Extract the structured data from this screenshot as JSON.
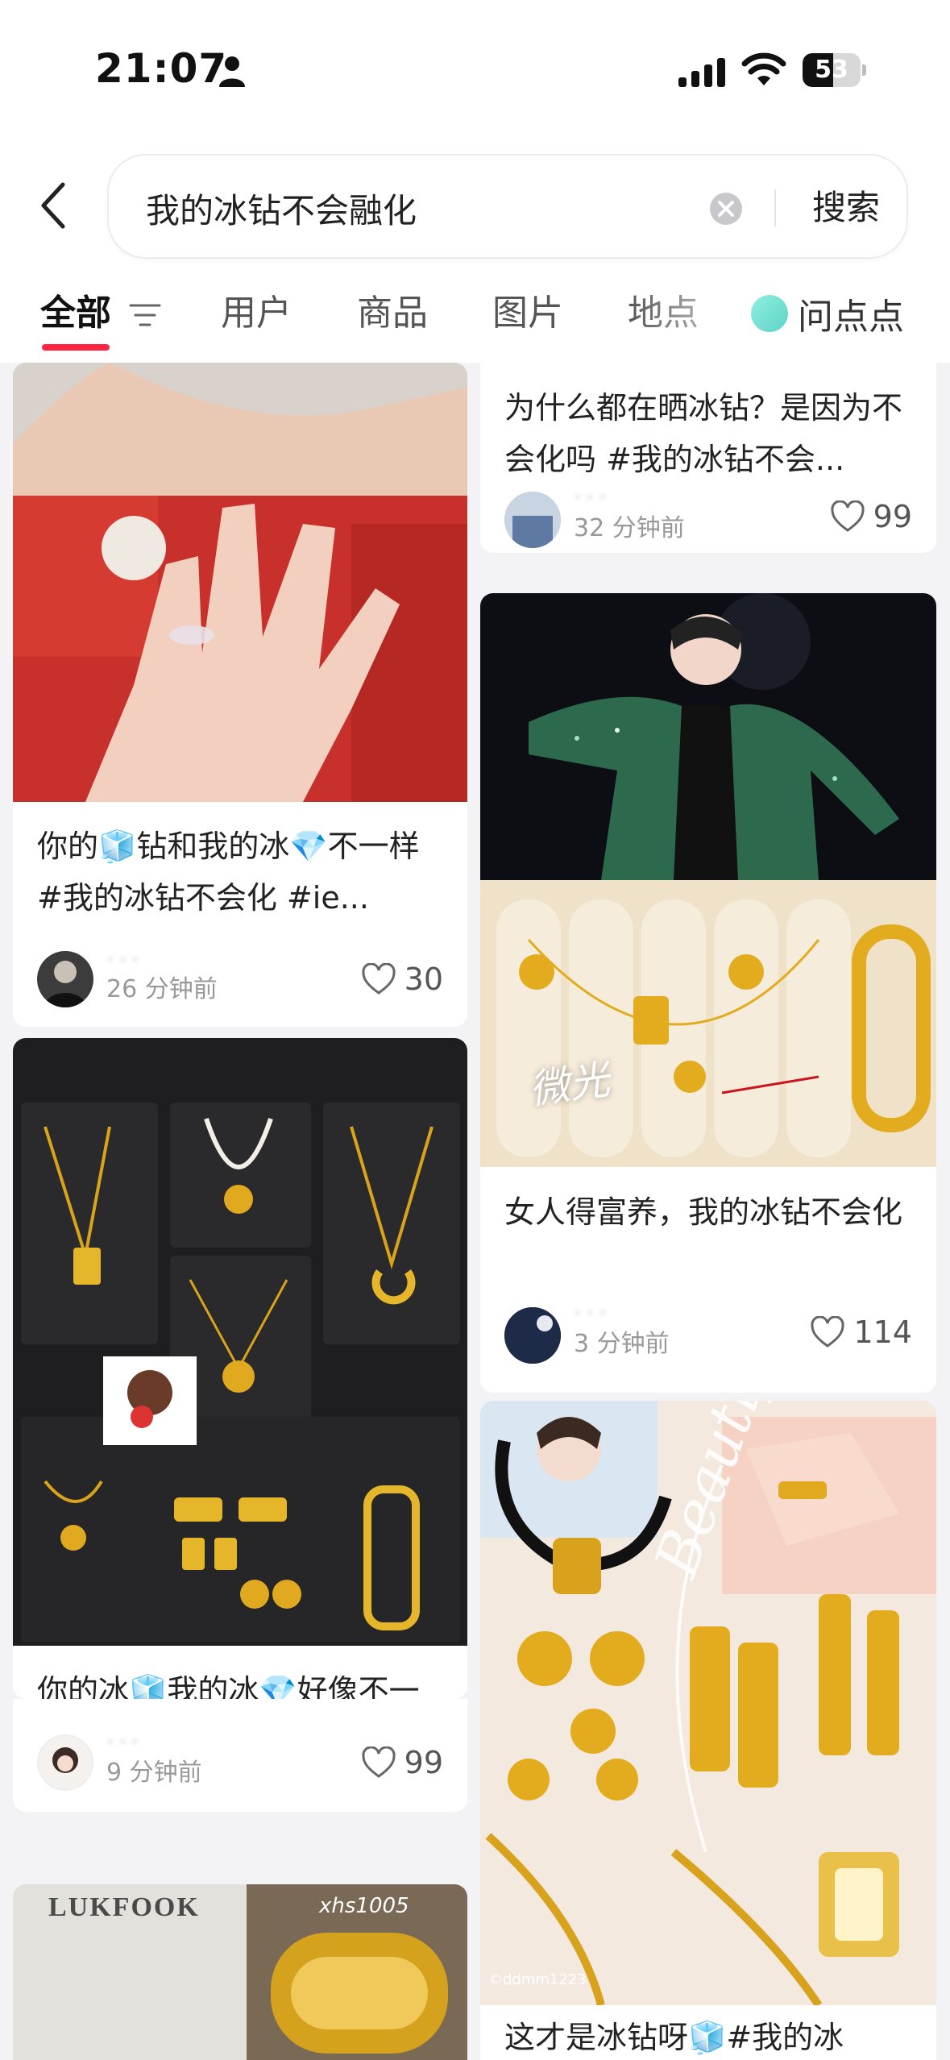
{
  "status_bar": {
    "time": "21:07",
    "battery": "53",
    "battery_level": 0.53
  },
  "search": {
    "query": "我的冰钻不会融化",
    "button_label": "搜索"
  },
  "tabs": [
    {
      "label": "全部"
    },
    {
      "label": "用户"
    },
    {
      "label": "商品"
    },
    {
      "label": "图片"
    },
    {
      "label": "地点"
    }
  ],
  "wenddd": {
    "label": "问点点"
  },
  "feed": {
    "left": [
      {
        "title": "你的🧊钻和我的冰💎不一样 #我的冰钻不会化  #ie...",
        "author": "···",
        "time": "26 分钟前",
        "likes": "30"
      },
      {
        "title": "你的冰🧊我的冰💎好像不一样 #我的冰钻不会化  #...",
        "author": "···",
        "time": "9 分钟前",
        "likes": "99"
      },
      {
        "image_text": "LUKFOOK",
        "watermark": "xhs1005"
      }
    ],
    "right": [
      {
        "title": "为什么都在晒冰钻？是因为不会化吗 #我的冰钻不会...",
        "author": "···",
        "time": "32 分钟前",
        "likes": "99"
      },
      {
        "title": "女人得富养，我的冰钻不会化",
        "image_text": "微光",
        "author": "···",
        "time": "3 分钟前",
        "likes": "114"
      },
      {
        "title": "这才是冰钻呀🧊#我的冰",
        "watermark": "©ddmm1223",
        "overlay_text": "Beautiful Day"
      }
    ]
  }
}
